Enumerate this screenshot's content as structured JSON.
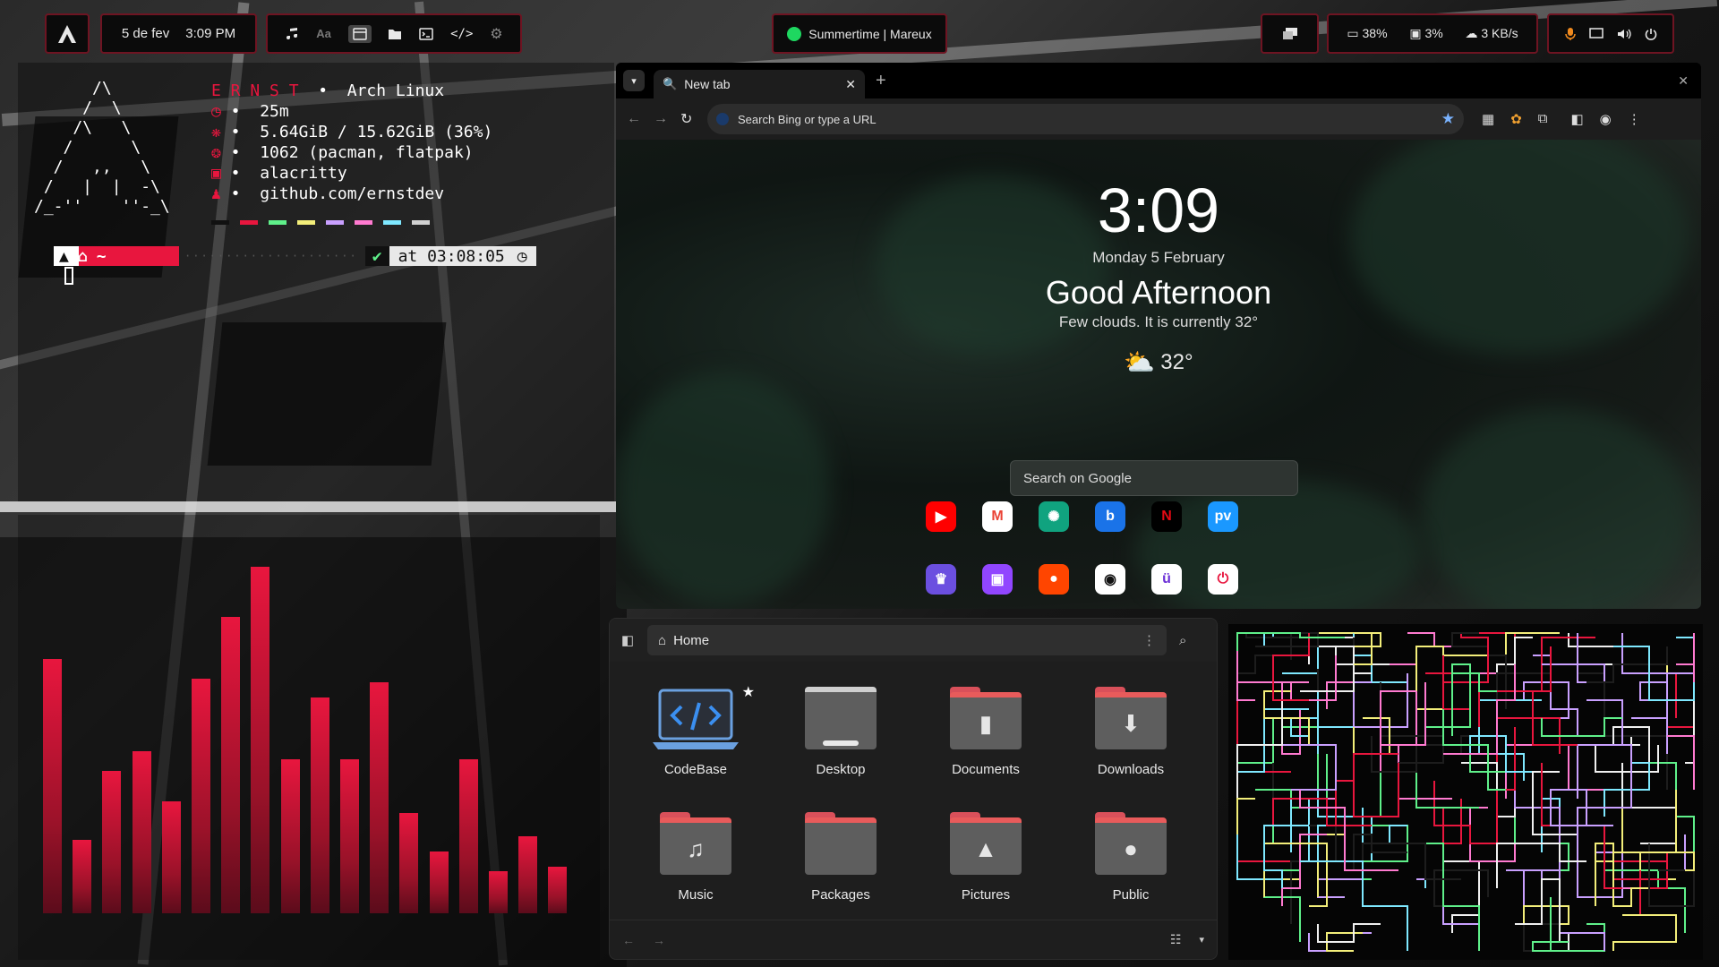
{
  "topbar": {
    "date": "5 de fev",
    "time": "3:09 PM",
    "music": "Summertime | Mareux",
    "battery": "38%",
    "disk": "3%",
    "net": "3 KB/s"
  },
  "terminal": {
    "brand": "E R N S T",
    "os": "Arch Linux",
    "uptime": "25m",
    "memory": "5.64GiB / 15.62GiB (36%)",
    "packages": "1062 (pacman, flatpak)",
    "shell": "alacritty",
    "github": "github.com/ernstdev",
    "prompt_time": "at 03:08:05",
    "prompt_dir": "~",
    "check": "✔",
    "ascii_logo": "      /\\\n     /  \\\n    /\\   \\\n   /      \\\n  /   ,,   \\\n /   |  |  -\\\n/_-''    ''-_\\",
    "palette": [
      "#111111",
      "#e8163e",
      "#5ff08a",
      "#f3ee7a",
      "#c9a0ff",
      "#ff7ad0",
      "#7fe8ff",
      "#d0d0d0"
    ]
  },
  "browser": {
    "tab_title": "New tab",
    "url_placeholder": "Search Bing or type a URL",
    "clock": "3:09",
    "date": "Monday 5 February",
    "greeting": "Good Afternoon",
    "weather_text": "Few clouds. It is currently 32°",
    "temp": "32°",
    "search_placeholder": "Search on Google",
    "shortcuts": [
      "YouTube",
      "Gmail",
      "ChatGPT",
      "Bing",
      "Netflix",
      "Prime Video",
      "Kick",
      "Twitch",
      "Reddit",
      "GitHub",
      "Udemy",
      "Mastodon"
    ]
  },
  "files": {
    "location": "Home",
    "folders": [
      "CodeBase",
      "Desktop",
      "Documents",
      "Downloads",
      "Music",
      "Packages",
      "Pictures",
      "Public"
    ]
  },
  "visualizer": {
    "levels": [
      0.66,
      0.19,
      0.37,
      0.42,
      0.29,
      0.61,
      0.77,
      0.9,
      0.4,
      0.56,
      0.4,
      0.6,
      0.26,
      0.16,
      0.4,
      0.11,
      0.2,
      0.12
    ]
  },
  "colors": {
    "accent": "#e8163e",
    "border": "#6e1422",
    "folder": "#5e5e5e",
    "folder_tab": "#e85b5b"
  }
}
